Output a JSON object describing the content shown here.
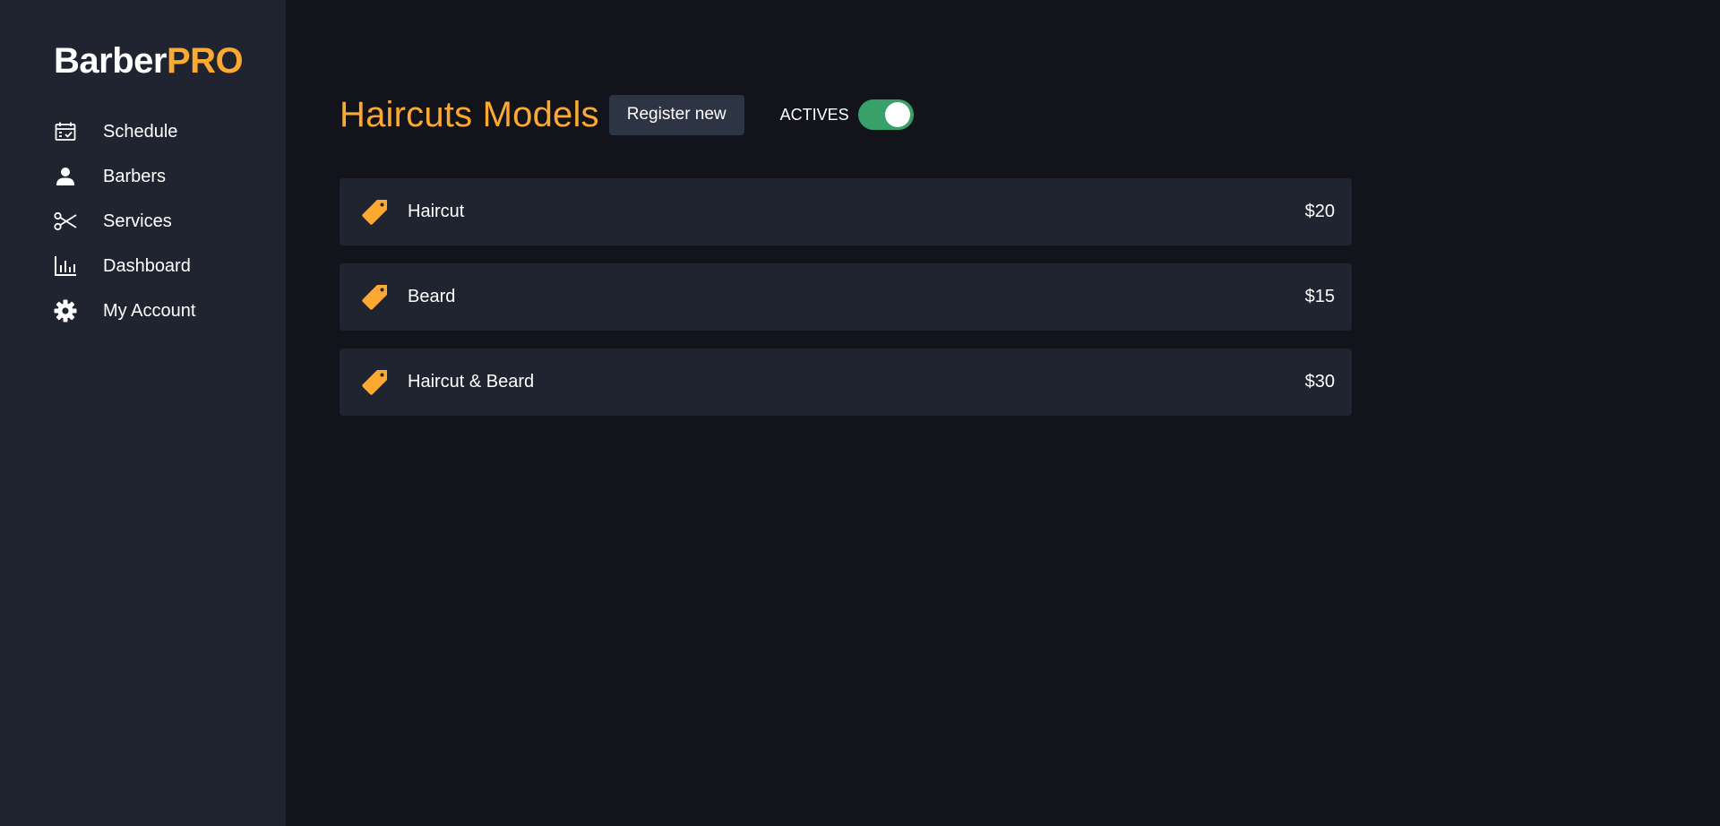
{
  "brand": {
    "name_part1": "Barber",
    "name_part2": "PRO",
    "accent_color": "#fba931"
  },
  "sidebar": {
    "items": [
      {
        "label": "Schedule",
        "icon": "calendar-check-icon"
      },
      {
        "label": "Barbers",
        "icon": "user-icon"
      },
      {
        "label": "Services",
        "icon": "scissors-icon"
      },
      {
        "label": "Dashboard",
        "icon": "bar-chart-icon"
      },
      {
        "label": "My Account",
        "icon": "gear-icon"
      }
    ]
  },
  "main": {
    "title": "Haircuts Models",
    "register_button": "Register new",
    "toggle": {
      "label": "ACTIVES",
      "on": true,
      "color": "#38a169"
    },
    "services": [
      {
        "name": "Haircut",
        "price": "$20",
        "icon": "tag-icon"
      },
      {
        "name": "Beard",
        "price": "$15",
        "icon": "tag-icon"
      },
      {
        "name": "Haircut & Beard",
        "price": "$30",
        "icon": "tag-icon"
      }
    ]
  }
}
